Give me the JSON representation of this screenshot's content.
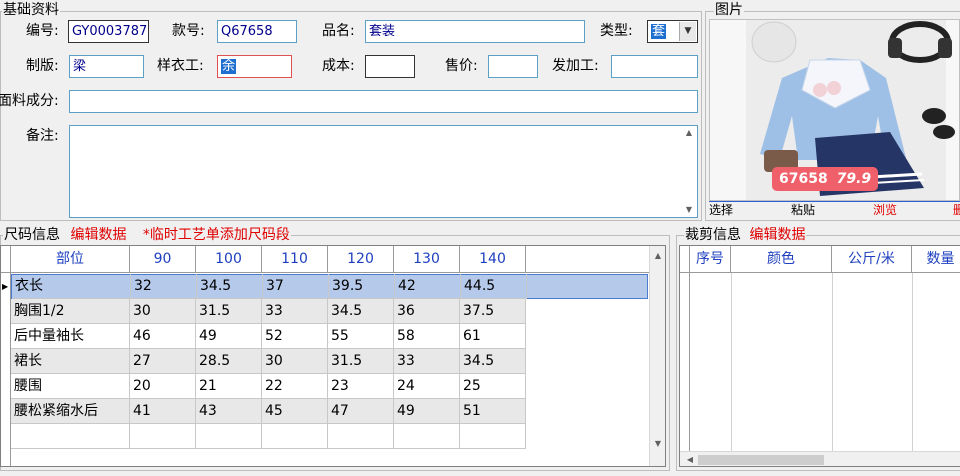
{
  "basic": {
    "legend": "基础资料",
    "code_label": "编号:",
    "code_value": "GY0003787",
    "style_label": "款号:",
    "style_value": "Q67658",
    "name_label": "品名:",
    "name_value": "套装",
    "type_label": "类型:",
    "type_value": "套",
    "maker_label": "制版:",
    "maker_value": "梁",
    "sample_label": "样衣工:",
    "sample_value": "余",
    "cost_label": "成本:",
    "cost_value": "",
    "price_label": "售价:",
    "price_value": "",
    "process_label": "发加工:",
    "process_value": "",
    "fabric_label": "面料成分:",
    "fabric_value": "",
    "remark_label": "备注:",
    "remark_value": ""
  },
  "picture": {
    "legend": "图片",
    "overlay_code": "67658",
    "overlay_price": "79.9",
    "buttons": [
      "选择",
      "粘贴",
      "浏览",
      "删"
    ]
  },
  "size_section": {
    "legend": "尺码信息",
    "edit_link": "编辑数据",
    "note": "*临时工艺单添加尺码段",
    "columns": [
      "部位",
      "90",
      "100",
      "110",
      "120",
      "130",
      "140"
    ],
    "rows": [
      [
        "衣长",
        "32",
        "34.5",
        "37",
        "39.5",
        "42",
        "44.5"
      ],
      [
        "胸围1/2",
        "30",
        "31.5",
        "33",
        "34.5",
        "36",
        "37.5"
      ],
      [
        "后中量袖长",
        "46",
        "49",
        "52",
        "55",
        "58",
        "61"
      ],
      [
        "裙长",
        "27",
        "28.5",
        "30",
        "31.5",
        "33",
        "34.5"
      ],
      [
        "腰围",
        "20",
        "21",
        "22",
        "23",
        "24",
        "25"
      ],
      [
        "腰松紧缩水后",
        "41",
        "43",
        "45",
        "47",
        "49",
        "51"
      ]
    ]
  },
  "cut_section": {
    "legend": "裁剪信息",
    "edit_link": "编辑数据",
    "columns": [
      "序号",
      "颜色",
      "公斤/米",
      "数量"
    ]
  },
  "colors": {
    "field_border": "#5ca0c8",
    "header_text": "#1d3fc0",
    "selected_row": "#b5c9ea",
    "link_red": "#e00000"
  }
}
